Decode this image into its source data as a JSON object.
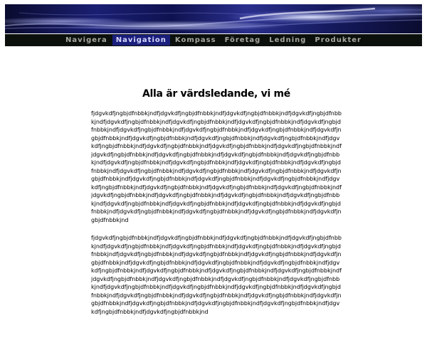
{
  "nav": {
    "items": [
      {
        "label": "Navigera"
      },
      {
        "label": "Navigation"
      },
      {
        "label": "Kompass"
      },
      {
        "label": "Företag"
      },
      {
        "label": "Ledning"
      },
      {
        "label": "Produkter"
      }
    ]
  },
  "main": {
    "title": "Alla är värdsledande, vi mé",
    "paragraphs": [
      "fjdgvkdfjngbjdfnbbkjndfjdgvkdfjngbjdfnbbkjndfjdgvkdfjngbjdfnbbkjndfjdgvkdfjngbjdfnbbkjndfjdgvkdfjngbjdfnbbkjndfjdgvkdfjngbjdfnbbkjndfjdgvkdfjngbjdfnbbkjndfjdgvkdfjngbjdfnbbkjndfjdgvkdfjngbjdfnbbkjndfjdgvkdfjngbjdfnbbkjndfjdgvkdfjngbjdfnbbkjndfjdgvkdfjngbjdfnbbkjndfjdgvkdfjngbjdfnbbkjndfjdgvkdfjngbjdfnbbkjndfjdgvkdfjngbjdfnbbkjndfjdgvkdfjngbjdfnbbkjndfjdgvkdfjngbjdfnbbkjndfjdgvkdfjngbjdfnbbkjndfjdgvkdfjngbjdfnbbkjndfjdgvkdfjngbjdfnbbkjndfjdgvkdfjngbjdfnbbkjndfjdgvkdfjngbjdfnbbkjndfjdgvkdfjngbjdfnbbkjndfjdgvkdfjngbjdfnbbkjndfjdgvkdfjngbjdfnbbkjndfjdgvkdfjngbjdfnbbkjndfjdgvkdfjngbjdfnbbkjndfjdgvkdfjngbjdfnbbkjndfjdgvkdfjngbjdfnbbkjndfjdgvkdfjngbjdfnbbkjndfjdgvkdfjngbjdfnbbkjndfjdgvkdfjngbjdfnbbkjndfjdgvkdfjngbjdfnbbkjndfjdgvkdfjngbjdfnbbkjndfjdgvkdfjngbjdfnbbkjndfjdgvkdfjngbjdfnbbkjndfjdgvkdfjngbjdfnbbkjndfjdgvkdfjngbjdfnbbkjndfjdgvkdfjngbjdfnbbkjndfjdgvkdfjngbjdfnbbkjndfjdgvkdfjngbjdfnbbkjndfjdgvkdfjngbjdfnbbkjndfjdgvkdfjngbjdfnbbkjndfjdgvkdfjngbjdfnbbkjndfjdgvkdfjngbjdfnbbkjndfjdgvkdfjngbjdfnbbkjndfjdgvkdfjngbjdfnbbkjndfjdgvkdfjngbjdfnbbkjndfjdgvkdfjngbjdfnbbkjndfjdgvkdfjngbjdfnbbkjnd",
      "fjdgvkdfjngbjdfnbbkjndfjdgvkdfjngbjdfnbbkjndfjdgvkdfjngbjdfnbbkjndfjdgvkdfjngbjdfnbbkjndfjdgvkdfjngbjdfnbbkjndfjdgvkdfjngbjdfnbbkjndfjdgvkdfjngbjdfnbbkjndfjdgvkdfjngbjdfnbbkjndfjdgvkdfjngbjdfnbbkjndfjdgvkdfjngbjdfnbbkjndfjdgvkdfjngbjdfnbbkjndfjdgvkdfjngbjdfnbbkjndfjdgvkdfjngbjdfnbbkjndfjdgvkdfjngbjdfnbbkjndfjdgvkdfjngbjdfnbbkjndfjdgvkdfjngbjdfnbbkjndfjdgvkdfjngbjdfnbbkjndfjdgvkdfjngbjdfnbbkjndfjdgvkdfjngbjdfnbbkjndfjdgvkdfjngbjdfnbbkjndfjdgvkdfjngbjdfnbbkjndfjdgvkdfjngbjdfnbbkjndfjdgvkdfjngbjdfnbbkjndfjdgvkdfjngbjdfnbbkjndfjdgvkdfjngbjdfnbbkjndfjdgvkdfjngbjdfnbbkjndfjdgvkdfjngbjdfnbbkjndfjdgvkdfjngbjdfnbbkjndfjdgvkdfjngbjdfnbbkjndfjdgvkdfjngbjdfnbbkjndfjdgvkdfjngbjdfnbbkjndfjdgvkdfjngbjdfnbbkjndfjdgvkdfjngbjdfnbbkjndfjdgvkdfjngbjdfnbbkjndfjdgvkdfjngbjdfnbbkjndfjdgvkdfjngbjdfnbbkjnd"
    ]
  },
  "colors": {
    "nav_background": "#0c100c",
    "nav_text": "#a8a8a0",
    "nav_active_background": "#1a1f7c",
    "banner_dark": "#0a0b2e",
    "banner_blue": "#2a2f8c"
  },
  "state": {
    "active_nav_index": 1
  }
}
